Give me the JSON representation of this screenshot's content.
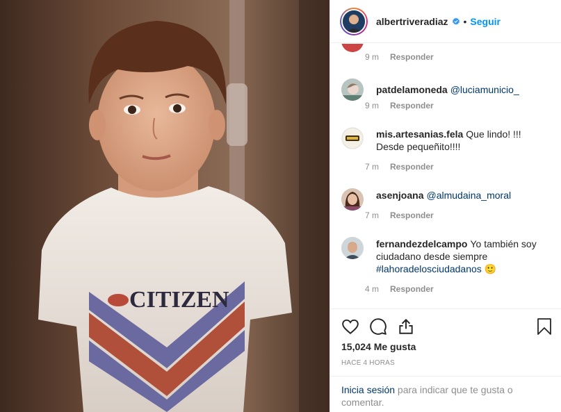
{
  "post": {
    "username": "albertriveradiaz",
    "separator": "•",
    "follow_label": "Seguir",
    "shirt_text": "CITIZEN",
    "icons": [
      "verified-badge-icon",
      "heart-icon",
      "comment-icon",
      "share-icon",
      "bookmark-icon"
    ]
  },
  "comments": [
    {
      "user": "",
      "text": "",
      "time": "9 m",
      "reply": "Responder"
    },
    {
      "user": "patdelamoneda",
      "mention": "@luciamunicio_",
      "time": "9 m",
      "reply": "Responder"
    },
    {
      "user": "mis.artesanias.fela",
      "text_line1": "Que lindo! !!!",
      "text_line2": "Desde pequeñito!!!!",
      "time": "7 m",
      "reply": "Responder"
    },
    {
      "user": "asenjoana",
      "mention": "@almudaina_moral",
      "time": "7 m",
      "reply": "Responder"
    },
    {
      "user": "fernandezdelcampo",
      "text_line1": "Yo también soy",
      "text_line2": "ciudadano desde siempre",
      "tag": "#lahoradelosciudadanos",
      "emoji": "🙂",
      "time": "4 m",
      "reply": "Responder"
    }
  ],
  "footer": {
    "likes": "15,024 Me gusta",
    "time": "HACE 4 HORAS",
    "login_link": "Inicia sesión",
    "login_text": " para indicar que te gusta o comentar."
  },
  "colors": {
    "link": "#0095f6",
    "mention": "#00376b",
    "muted": "#8e8e8e",
    "verified": "#3897f0"
  }
}
